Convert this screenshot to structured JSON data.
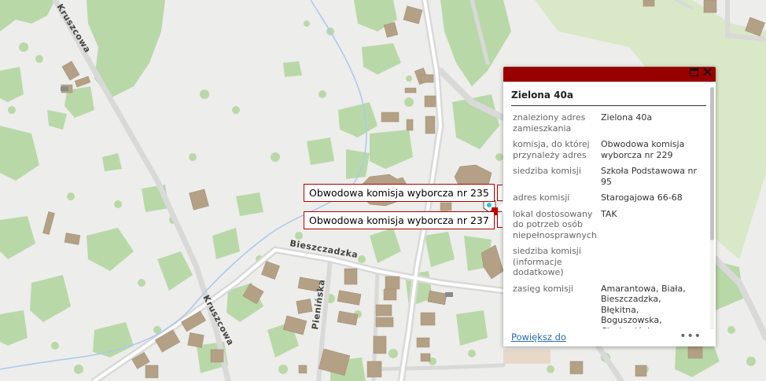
{
  "map": {
    "streets": {
      "kruszcowa_top": "Kruszcowa",
      "kruszcowa_bottom": "Kruszcowa",
      "bieszczadzka": "Bieszczadzka",
      "pieninska": "Pienińska"
    },
    "callouts": [
      "Obwodowa komisja wyborcza nr 235",
      "Obwodowa komisja wyborcza nr 237"
    ],
    "colors": {
      "background": "#ededeb",
      "vegetation": "#b7d7a6",
      "park": "#d8e8c4",
      "building": "#b4a185",
      "road": "#d8d8d8",
      "water": "#aac8ee",
      "popup_header": "#980000",
      "callout_border": "#b00000"
    }
  },
  "popup": {
    "title": "Zielona 40a",
    "maximize_icon": "maximize-icon",
    "close_icon": "close-icon",
    "rows": [
      {
        "key": "znaleziony adres zamieszkania",
        "value": "Zielona 40a"
      },
      {
        "key": "komisja, do której przynależy adres",
        "value": "Obwodowa komisja wyborcza nr 229"
      },
      {
        "key": "siedziba komisji",
        "value": "Szkoła Podstawowa nr 95"
      },
      {
        "key": "adres komisji",
        "value": "Starogajowa 66-68"
      },
      {
        "key": "lokal dostosowany do potrzeb osób niepełnosprawnych",
        "value": "TAK"
      },
      {
        "key": "siedziba komisji (informacje dodatkowe)",
        "value": ""
      },
      {
        "key": "zasięg komisji",
        "value": "Amarantowa, Biała, Bieszczadzka, Błękitna, Boguszowska, Ciechocińska,"
      }
    ],
    "zoom_link": "Powiększ do",
    "more": "•••"
  }
}
